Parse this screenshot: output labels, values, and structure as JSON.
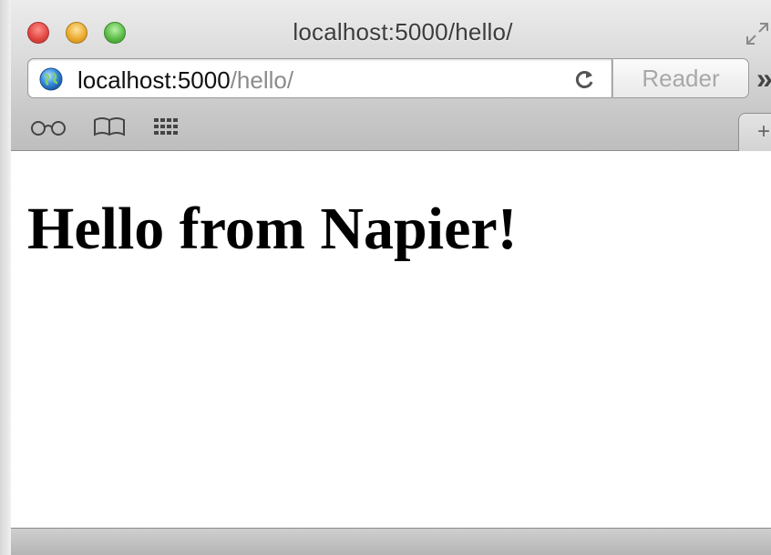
{
  "window": {
    "title": "localhost:5000/hello/"
  },
  "toolbar": {
    "url_host": "localhost:5000",
    "url_path": "/hello/",
    "reader_label": "Reader",
    "more_label": "»"
  },
  "bookmarks": {
    "icons": [
      "reading-list-icon",
      "bookmarks-book-icon",
      "top-sites-grid-icon"
    ]
  },
  "tabs": {
    "new_tab_label": "+"
  },
  "page": {
    "heading": "Hello from Napier!"
  },
  "colors": {
    "accent_blue": "#2a7fd4",
    "chrome_gray": "#c9c9c9"
  }
}
